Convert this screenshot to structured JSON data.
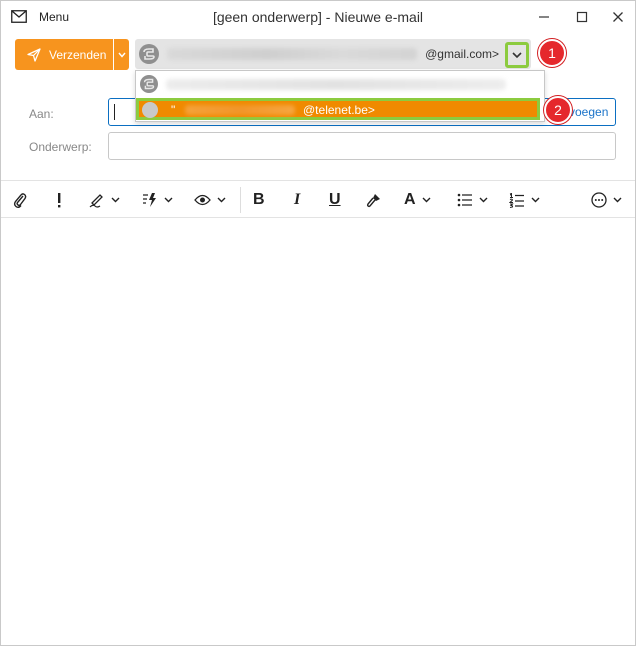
{
  "window": {
    "menu_label": "Menu",
    "title": "[geen onderwerp] - Nieuwe e-mail"
  },
  "compose": {
    "send_label": "Verzenden",
    "from_email": "@gmail.com>",
    "to_label": "Aan:",
    "subject_label": "Onderwerp:",
    "add_link": "voegen",
    "to_value": "",
    "subject_value": ""
  },
  "from_dropdown": {
    "options": [
      {
        "quote": "",
        "email": ""
      },
      {
        "quote": "\"",
        "email": "@telenet.be>"
      }
    ]
  },
  "annotations": {
    "step1": "1",
    "step2": "2"
  },
  "toolbar": {
    "bold": "B",
    "italic": "I",
    "underline": "U",
    "font_color": "A"
  },
  "colors": {
    "accent_orange": "#f7941e",
    "highlight_green": "#8ccb3f",
    "badge_red": "#e5282c",
    "link_blue": "#1a73c8"
  }
}
